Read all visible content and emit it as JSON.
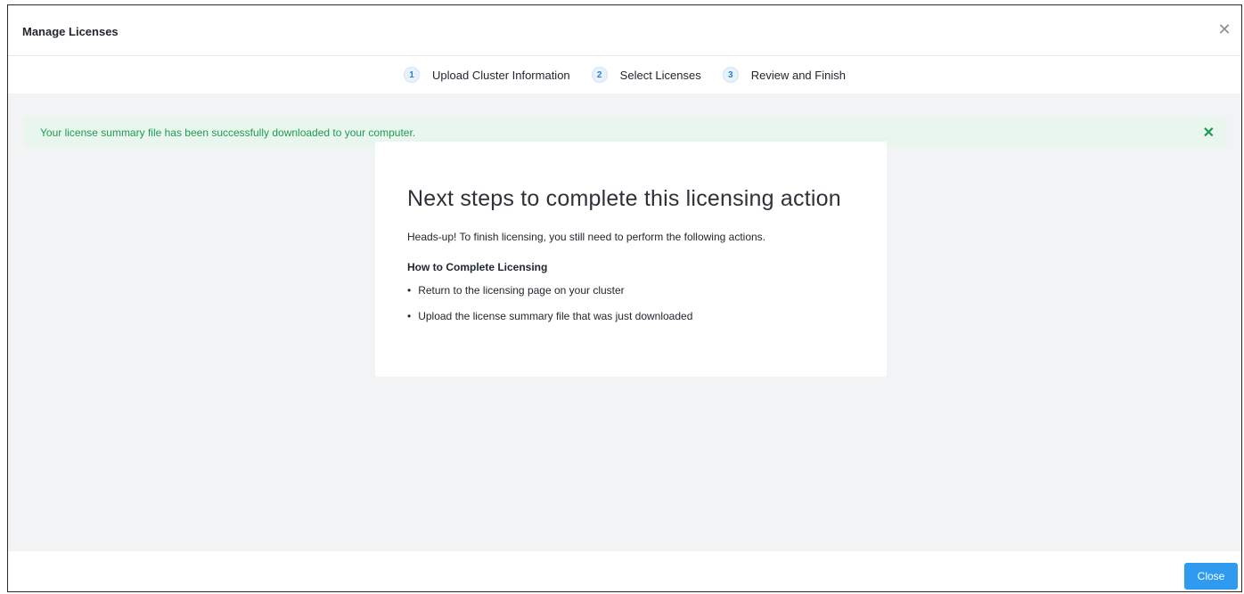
{
  "dialog": {
    "title": "Manage Licenses",
    "close_icon": "close-icon"
  },
  "steps": [
    {
      "number": "1",
      "label": "Upload Cluster Information"
    },
    {
      "number": "2",
      "label": "Select Licenses"
    },
    {
      "number": "3",
      "label": "Review and Finish"
    }
  ],
  "alert": {
    "message": "Your license summary file has been successfully downloaded to your computer.",
    "dismiss_icon": "close-icon",
    "color": "#1f9a54"
  },
  "card": {
    "heading": "Next steps to complete this licensing action",
    "lead": "Heads-up! To finish licensing, you still need to perform the following actions.",
    "subheading": "How to Complete Licensing",
    "items": [
      "Return to the licensing page on your cluster",
      "Upload the license summary file that was just downloaded"
    ]
  },
  "footer": {
    "close_label": "Close",
    "accent": "#2f9bf0"
  }
}
